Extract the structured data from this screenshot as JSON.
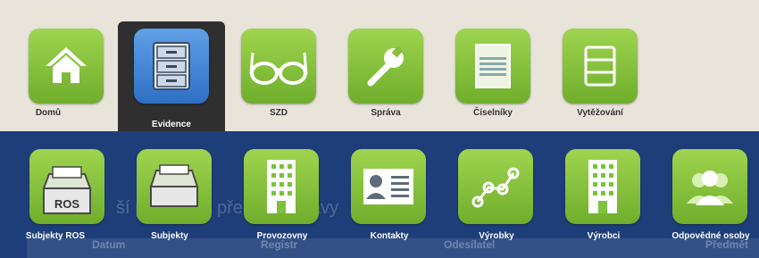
{
  "nav": {
    "items": [
      {
        "label": "Domů",
        "icon": "home-icon"
      },
      {
        "label": "Evidence",
        "icon": "filing-cabinet-icon",
        "active": true
      },
      {
        "label": "SZD",
        "icon": "glasses-icon"
      },
      {
        "label": "Správa",
        "icon": "wrench-icon"
      },
      {
        "label": "Číselníky",
        "icon": "numbers-sheet-icon"
      },
      {
        "label": "Vytěžování",
        "icon": "list-icon"
      }
    ]
  },
  "submenu": {
    "items": [
      {
        "label": "Subjekty ROS",
        "icon": "inbox-ros-icon",
        "badge": "ROS"
      },
      {
        "label": "Subjekty",
        "icon": "inbox-icon"
      },
      {
        "label": "Provozovny",
        "icon": "building-icon"
      },
      {
        "label": "Kontakty",
        "icon": "contact-card-icon"
      },
      {
        "label": "Výrobky",
        "icon": "chain-nodes-icon"
      },
      {
        "label": "Výrobci",
        "icon": "building-icon"
      },
      {
        "label": "Odpovědné osoby",
        "icon": "people-icon"
      }
    ]
  },
  "background": {
    "heading_fragment_1": "ší po",
    "heading_fragment_2": "přeč",
    "heading_fragment_3": "ávy",
    "columns": [
      "Datum",
      "Registr",
      "Odesílatel",
      "Předmět"
    ]
  },
  "colors": {
    "tile_green": "#7cc23a",
    "tile_blue": "#3b7fd6",
    "panel": "#1e3e7a",
    "topbar": "#e9e4da"
  }
}
